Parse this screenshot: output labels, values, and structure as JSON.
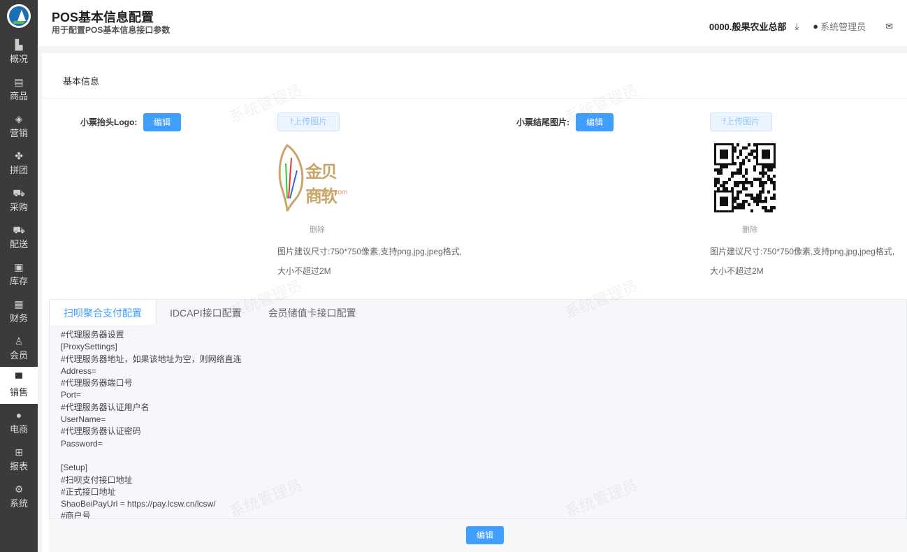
{
  "sidebar": {
    "items": [
      {
        "label": "概况",
        "icon": "building-icon",
        "glyph": "▙"
      },
      {
        "label": "商品",
        "icon": "document-icon",
        "glyph": "▤"
      },
      {
        "label": "营销",
        "icon": "bag-icon",
        "glyph": "◈"
      },
      {
        "label": "拼团",
        "icon": "clover-icon",
        "glyph": "✤"
      },
      {
        "label": "采购",
        "icon": "cart-icon",
        "glyph": "⛟"
      },
      {
        "label": "配送",
        "icon": "truck-icon",
        "glyph": "⛟"
      },
      {
        "label": "库存",
        "icon": "box-icon",
        "glyph": "▣"
      },
      {
        "label": "财务",
        "icon": "money-icon",
        "glyph": "▦"
      },
      {
        "label": "会员",
        "icon": "person-icon",
        "glyph": "♙"
      },
      {
        "label": "销售",
        "icon": "register-icon",
        "glyph": "▀"
      },
      {
        "label": "电商",
        "icon": "user-icon",
        "glyph": "●"
      },
      {
        "label": "报表",
        "icon": "chart-board-icon",
        "glyph": "⊞"
      },
      {
        "label": "系统",
        "icon": "gear-icon",
        "glyph": "⚙"
      }
    ],
    "active": "销售"
  },
  "header": {
    "title": "POS基本信息配置",
    "subtitle": "用于配置POS基本信息接口参数",
    "org": "0000.般果农业总部",
    "user": "系统管理员"
  },
  "section": {
    "title": "基本信息"
  },
  "logo_field": {
    "label": "小票抬头Logo:",
    "edit": "编辑",
    "upload": "上传图片",
    "delete": "删除",
    "hint": "图片建议尺寸:750*750像素,支持png,jpg,jpeg格式,大小不超过2M",
    "image_text": "金贝商软",
    "image_sub": "ymjinbei.com"
  },
  "footer_field": {
    "label": "小票结尾图片:",
    "edit": "编辑",
    "upload": "上传图片",
    "delete": "删除",
    "hint": "图片建议尺寸:750*750像素,支持png,jpg,jpeg格式,大小不超过2M"
  },
  "tabs": [
    {
      "label": "扫呗聚合支付配置"
    },
    {
      "label": "IDCAPI接口配置"
    },
    {
      "label": "会员储值卡接口配置"
    }
  ],
  "config_text": "#代理服务器设置\n[ProxySettings]\n#代理服务器地址，如果该地址为空，则网络直连\nAddress=\n#代理服务器端口号\nPort=\n#代理服务器认证用户名\nUserName=\n#代理服务器认证密码\nPassword=\n\n[Setup]\n#扫呗支付接口地址\n#正式接口地址\nShaoBeiPayUrl = https://pay.lcsw.cn/lcsw/\n#商户号",
  "footer": {
    "edit": "编辑"
  },
  "watermark": "系统管理员"
}
